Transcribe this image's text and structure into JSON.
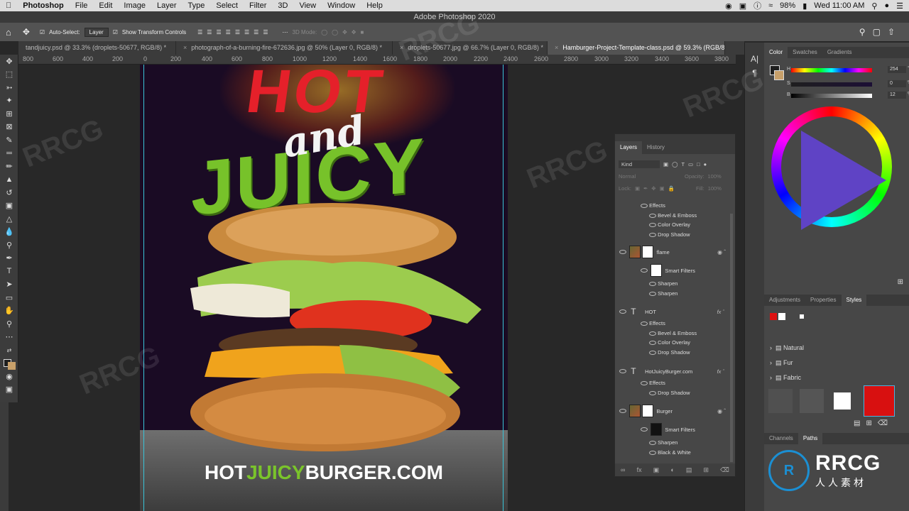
{
  "menubar": {
    "apple": "",
    "app_name": "Photoshop",
    "items": [
      "File",
      "Edit",
      "Image",
      "Layer",
      "Type",
      "Select",
      "Filter",
      "3D",
      "View",
      "Window",
      "Help"
    ],
    "battery": "98%",
    "clock": "Wed 11:00 AM"
  },
  "window_title": "Adobe Photoshop 2020",
  "options": {
    "auto_select_label": "Auto-Select:",
    "auto_select_value": "Layer",
    "transform_label": "Show Transform Controls",
    "mode_label": "3D Mode:"
  },
  "tabs": [
    {
      "label": "tandjuicy.psd @ 33.3% (droplets-50677, RGB/8) *"
    },
    {
      "label": "photograph-of-a-burning-fire-672636.jpg @ 50% (Layer 0, RGB/8) *"
    },
    {
      "label": "droplets-50677.jpg @ 66.7% (Layer 0, RGB/8) *"
    },
    {
      "label": "Hamburger-Project-Template-class.psd @ 59.3% (RGB/8)"
    }
  ],
  "ruler_ticks": [
    "800",
    "600",
    "400",
    "200",
    "0",
    "200",
    "400",
    "600",
    "800",
    "1000",
    "1200",
    "1400",
    "1600",
    "1800",
    "2000",
    "2200",
    "2400",
    "2600",
    "2800",
    "3000",
    "3200",
    "3400",
    "3600",
    "3800"
  ],
  "poster": {
    "hot": "HOT",
    "and": "and",
    "juicy": "JUICY",
    "url_part1": "HOT",
    "url_part2": "JUICY",
    "url_part3": "BURGER.COM"
  },
  "layers_panel": {
    "tab_layers": "Layers",
    "tab_history": "History",
    "kind": "Kind",
    "blend": "Normal",
    "opacity_label": "Opacity:",
    "opacity": "100%",
    "lock_label": "Lock:",
    "fill_label": "Fill:",
    "fill": "100%",
    "rows": {
      "effects1": "Effects",
      "bevel1": "Bevel & Emboss",
      "overlay1": "Color Overlay",
      "shadow1": "Drop Shadow",
      "flame": "flame",
      "smart1": "Smart Filters",
      "sharpen1": "Sharpen",
      "sharpen2": "Sharpen",
      "hot": "HOT",
      "effects2": "Effects",
      "bevel2": "Bevel & Emboss",
      "overlay2": "Color Overlay",
      "shadow2": "Drop Shadow",
      "url": "HotJuicyBurger.com",
      "effects3": "Effects",
      "shadow3": "Drop Shadow",
      "burger": "Burger",
      "smart2": "Smart Filters",
      "sharpen3": "Sharpen",
      "bw": "Black & White"
    }
  },
  "color_panel": {
    "tabs": [
      "Color",
      "Swatches",
      "Gradients"
    ],
    "h_label": "H",
    "h_value": "254",
    "h_unit": "°",
    "s_label": "S",
    "s_value": "0",
    "s_unit": "%",
    "b_label": "B",
    "b_value": "12",
    "b_unit": "%"
  },
  "styles_panel": {
    "tabs": [
      "Adjustments",
      "Properties",
      "Styles"
    ],
    "folders": [
      "Natural",
      "Fur",
      "Fabric"
    ]
  },
  "paths_panel": {
    "tabs": [
      "Channels",
      "Paths"
    ],
    "logo_text": "RRCG",
    "logo_sub": "人人素材"
  },
  "watermark": "RRCG"
}
